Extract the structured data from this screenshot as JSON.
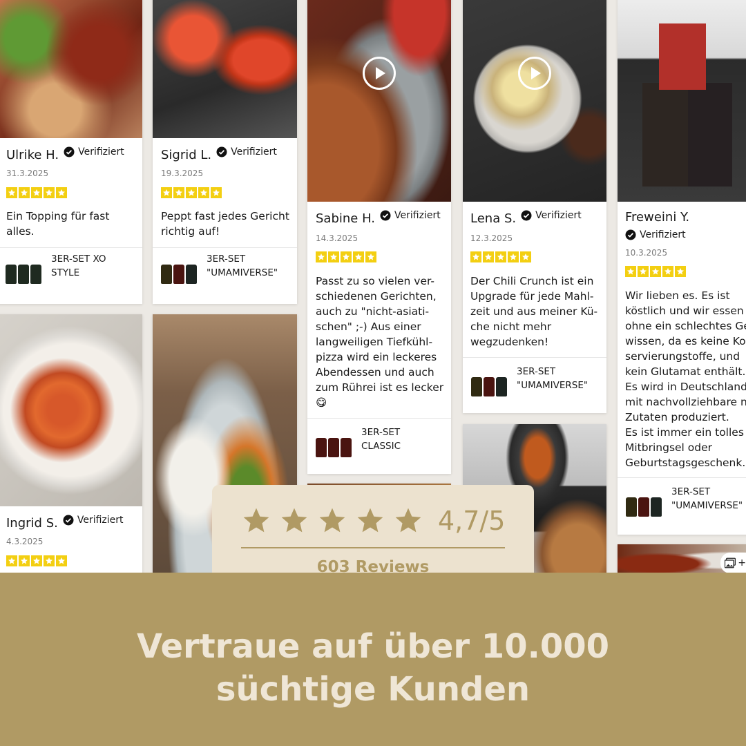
{
  "verified_label": "Verifiziert",
  "reviews": [
    {
      "name": "Ulrike H.",
      "date": "31.3.2025",
      "text": "Ein Topping für fast\nalles.",
      "product": "3ER-SET XO\nSTYLE"
    },
    {
      "name": "Sigrid L.",
      "date": "19.3.2025",
      "text": "Peppt fast jedes Gericht\nrichtig auf!",
      "product": "3ER-SET\n\"UMAMIVERSE\""
    },
    {
      "name": "Sabine H.",
      "date": "14.3.2025",
      "text": "Passt zu so vielen ver-\nschiedenen Gerichten,\nauch zu \"nicht-asiati-\nschen\" ;-) Aus einer\nlangweiligen Tiefkühl-\npizza wird ein leckeres\nAbendessen und auch\nzum Rührei ist es lecker\n😋",
      "product": "3ER-SET\nCLASSIC"
    },
    {
      "name": "Lena S.",
      "date": "12.3.2025",
      "text": "Der Chili Crunch ist ein\nUpgrade für jede Mahl-\nzeit und aus meiner Kü-\nche nicht mehr\nwegzudenken!",
      "product": "3ER-SET\n\"UMAMIVERSE\""
    },
    {
      "name": "Freweini Y.",
      "date": "10.3.2025",
      "text": "Wir lieben es. Es ist\nköstlich und wir essen e\nohne ein schlechtes Ge\nwissen, da es keine Kon\nservierungstoffe, und\nkein Glutamat enthält.\nEs wird in Deutschland\nmit nachvollziehbare n\nZutaten produziert.\nEs ist immer ein tolles\nMitbringsel oder\nGeburtstagsgeschenk.",
      "product": "3ER-SET\n\"UMAMIVERSE\""
    },
    {
      "name": "Ingrid S.",
      "date": "4.3.2025",
      "text": "",
      "product": ""
    }
  ],
  "review_stars": 5,
  "rating": {
    "score": "4,7/5",
    "count": "603  Reviews",
    "stars": 5
  },
  "headline": {
    "line1": "Vertraue auf über 10.000",
    "line2": "süchtige Kunden"
  },
  "gallery_more": "+",
  "colors": {
    "star_yellow": "#f3cf12",
    "gold": "#b09a64",
    "cream": "#ece2cf",
    "headline": "#efe6d6"
  },
  "icons": {
    "verified": "check-badge-icon",
    "play": "play-icon",
    "gallery": "image-gallery-icon",
    "star": "star-icon"
  }
}
